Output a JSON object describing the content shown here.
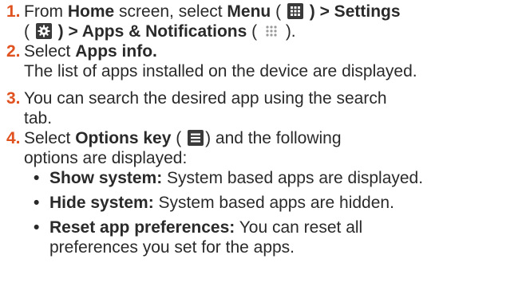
{
  "colors": {
    "accent": "#e0521f",
    "text": "#2a2a2a",
    "icon_bg": "#3a3a3a"
  },
  "steps": [
    {
      "number": "1.",
      "parts": {
        "p1": "From ",
        "home": "Home",
        "p2": " screen, select ",
        "menu": "Menu",
        "p3": " ( ",
        "p4": " ) > Settings",
        "p5": "( ",
        "p6": " ) > Apps & Notifications",
        "p7": " ( ",
        "p8": " )."
      },
      "icons": [
        "menu-grid-icon",
        "settings-gear-icon",
        "apps-dots-icon"
      ]
    },
    {
      "number": "2.",
      "parts": {
        "p1": "Select ",
        "bold": "Apps info.",
        "line2": "The list of apps installed on the device are displayed."
      }
    },
    {
      "number": "3.",
      "parts": {
        "line1": "You can search the desired app using the search",
        "line2": "tab."
      }
    },
    {
      "number": "4.",
      "parts": {
        "p1": "Select ",
        "bold": "Options key",
        "p2": " ( ",
        "p3": ")  and the following",
        "line2": "options are displayed:"
      },
      "icons": [
        "options-list-icon"
      ],
      "bullets": [
        {
          "bold": "Show system:",
          "text": " System based apps are displayed."
        },
        {
          "bold": "Hide system:",
          "text": " System based apps are hidden."
        },
        {
          "bold": "Reset app preferences:",
          "text": " You can reset all",
          "cont": "preferences you set for the apps."
        }
      ]
    }
  ]
}
